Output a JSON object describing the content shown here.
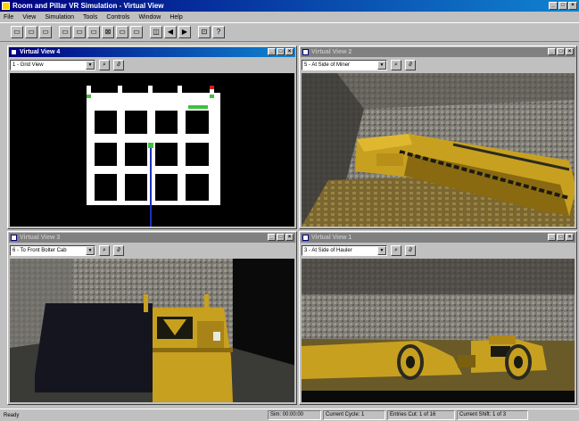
{
  "app": {
    "title": "Room and Pillar VR Simulation - Virtual View"
  },
  "window_buttons": {
    "minimize": "_",
    "maximize": "□",
    "close": "×"
  },
  "menu": [
    "File",
    "View",
    "Simulation",
    "Tools",
    "Controls",
    "Window",
    "Help"
  ],
  "toolbar": [
    "▭",
    "▭",
    "▭",
    "▭",
    "▭",
    "▭",
    "⊠",
    "▭",
    "▭",
    "◫",
    "◀",
    "▶",
    "⊡",
    "?"
  ],
  "views": [
    {
      "title": "Virtual View 4",
      "active": true,
      "camera": "1 - Grid View",
      "kind": "plan"
    },
    {
      "title": "Virtual View 2",
      "active": false,
      "camera": "5 - At Side of Miner",
      "kind": "miner"
    },
    {
      "title": "Virtual View 3",
      "active": false,
      "camera": "6 - To Front Bolter Cab",
      "kind": "bolter"
    },
    {
      "title": "Virtual View 1",
      "active": false,
      "camera": "3 - At Side of Hauler",
      "kind": "hauler"
    }
  ],
  "view_tools": {
    "zoom": "⌕",
    "tilt": "∂"
  },
  "status": {
    "ready": "Ready",
    "fields": [
      "Sim: 00:00:00",
      "Current Cycle: 1",
      "Entries Cut: 1 of 16",
      "Current Shift: 1 of 3"
    ]
  },
  "colors": {
    "accent": "#000080",
    "machine_yellow": "#c8a020",
    "rock_grey": "#8a8a86"
  }
}
